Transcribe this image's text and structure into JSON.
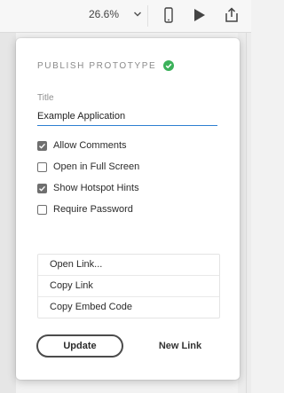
{
  "toolbar": {
    "zoom_value": "26.6%",
    "icons": [
      "chevron-down-icon",
      "phone-icon",
      "play-icon",
      "share-icon"
    ]
  },
  "popover": {
    "title": "PUBLISH PROTOTYPE",
    "status_color": "#3bb15a",
    "title_field": {
      "label": "Title",
      "value": "Example Application",
      "accent": "#2d7fd1"
    },
    "options": [
      {
        "label": "Allow Comments",
        "checked": true
      },
      {
        "label": "Open in Full Screen",
        "checked": false
      },
      {
        "label": "Show Hotspot Hints",
        "checked": true
      },
      {
        "label": "Require Password",
        "checked": false
      }
    ],
    "link_menu": [
      "Open Link...",
      "Copy Link",
      "Copy Embed Code"
    ],
    "update_label": "Update",
    "new_link_label": "New Link"
  }
}
